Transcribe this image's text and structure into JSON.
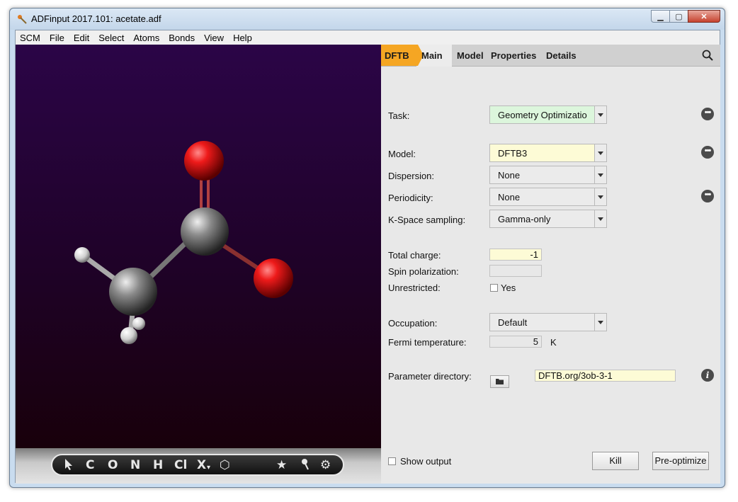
{
  "window": {
    "title": "ADFinput 2017.101: acetate.adf"
  },
  "menu": [
    "SCM",
    "File",
    "Edit",
    "Select",
    "Atoms",
    "Bonds",
    "View",
    "Help"
  ],
  "tabs": {
    "engine": "DFTB",
    "main": "Main",
    "model": "Model",
    "properties": "Properties",
    "details": "Details"
  },
  "toolbar": {
    "tools": [
      "C",
      "O",
      "N",
      "H",
      "Cl",
      "X"
    ]
  },
  "form": {
    "task": {
      "label": "Task:",
      "value": "Geometry Optimizatio"
    },
    "model": {
      "label": "Model:",
      "value": "DFTB3"
    },
    "dispersion": {
      "label": "Dispersion:",
      "value": "None"
    },
    "periodicity": {
      "label": "Periodicity:",
      "value": "None"
    },
    "kspace": {
      "label": "K-Space sampling:",
      "value": "Gamma-only"
    },
    "total_charge": {
      "label": "Total charge:",
      "value": "-1"
    },
    "spin_polarization": {
      "label": "Spin polarization:",
      "value": ""
    },
    "unrestricted": {
      "label": "Unrestricted:",
      "checkbox_label": "Yes"
    },
    "occupation": {
      "label": "Occupation:",
      "value": "Default"
    },
    "fermi_temperature": {
      "label": "Fermi temperature:",
      "value": "5",
      "unit": "K"
    },
    "parameter_directory": {
      "label": "Parameter directory:",
      "value": "DFTB.org/3ob-3-1"
    }
  },
  "footer": {
    "show_output": "Show output",
    "kill": "Kill",
    "preoptimize": "Pre-optimize"
  },
  "colors": {
    "accent_tab": "#f5a623",
    "task_bg": "#dcf6dc",
    "highlight_bg": "#fdfbd6"
  }
}
